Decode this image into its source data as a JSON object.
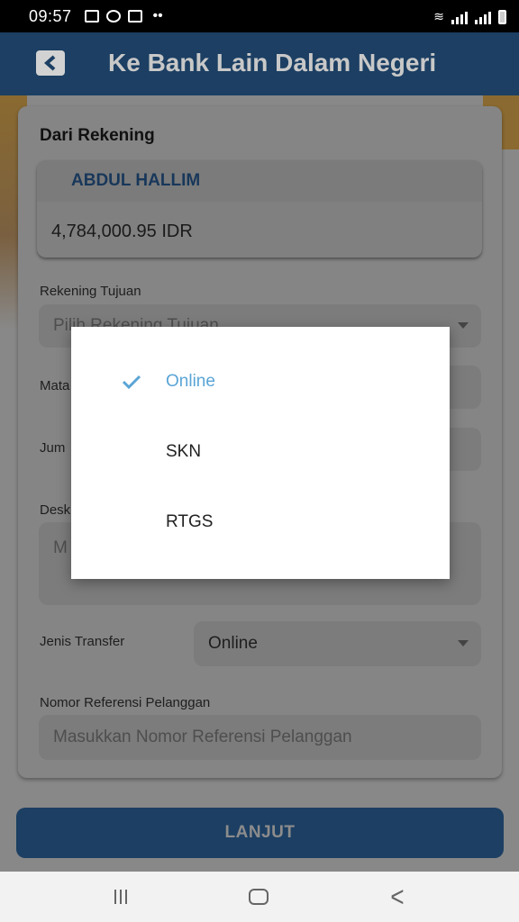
{
  "status_bar": {
    "time": "09:57"
  },
  "header": {
    "title": "Ke Bank Lain Dalam Negeri"
  },
  "form": {
    "section_title": "Dari Rekening",
    "account_name": "ABDUL HALLIM",
    "account_balance": "4,784,000.95 IDR",
    "tujuan_label": "Rekening Tujuan",
    "tujuan_placeholder": "Pilih Rekening Tujuan",
    "mata_label_visible": "Mata",
    "jumlah_label_visible": "Jum",
    "deskripsi_label_visible": "Desk",
    "deskripsi_placeholder_visible": "M",
    "jenis_label": "Jenis Transfer",
    "jenis_value": "Online",
    "referensi_label": "Nomor Referensi Pelanggan",
    "referensi_placeholder": "Masukkan Nomor Referensi Pelanggan"
  },
  "submit": {
    "label": "LANJUT"
  },
  "dialog": {
    "options": [
      "Online",
      "SKN",
      "RTGS"
    ],
    "selected": "Online"
  },
  "colors": {
    "header_blue": "#1c3f63",
    "selected_option": "#5aa5d6"
  }
}
